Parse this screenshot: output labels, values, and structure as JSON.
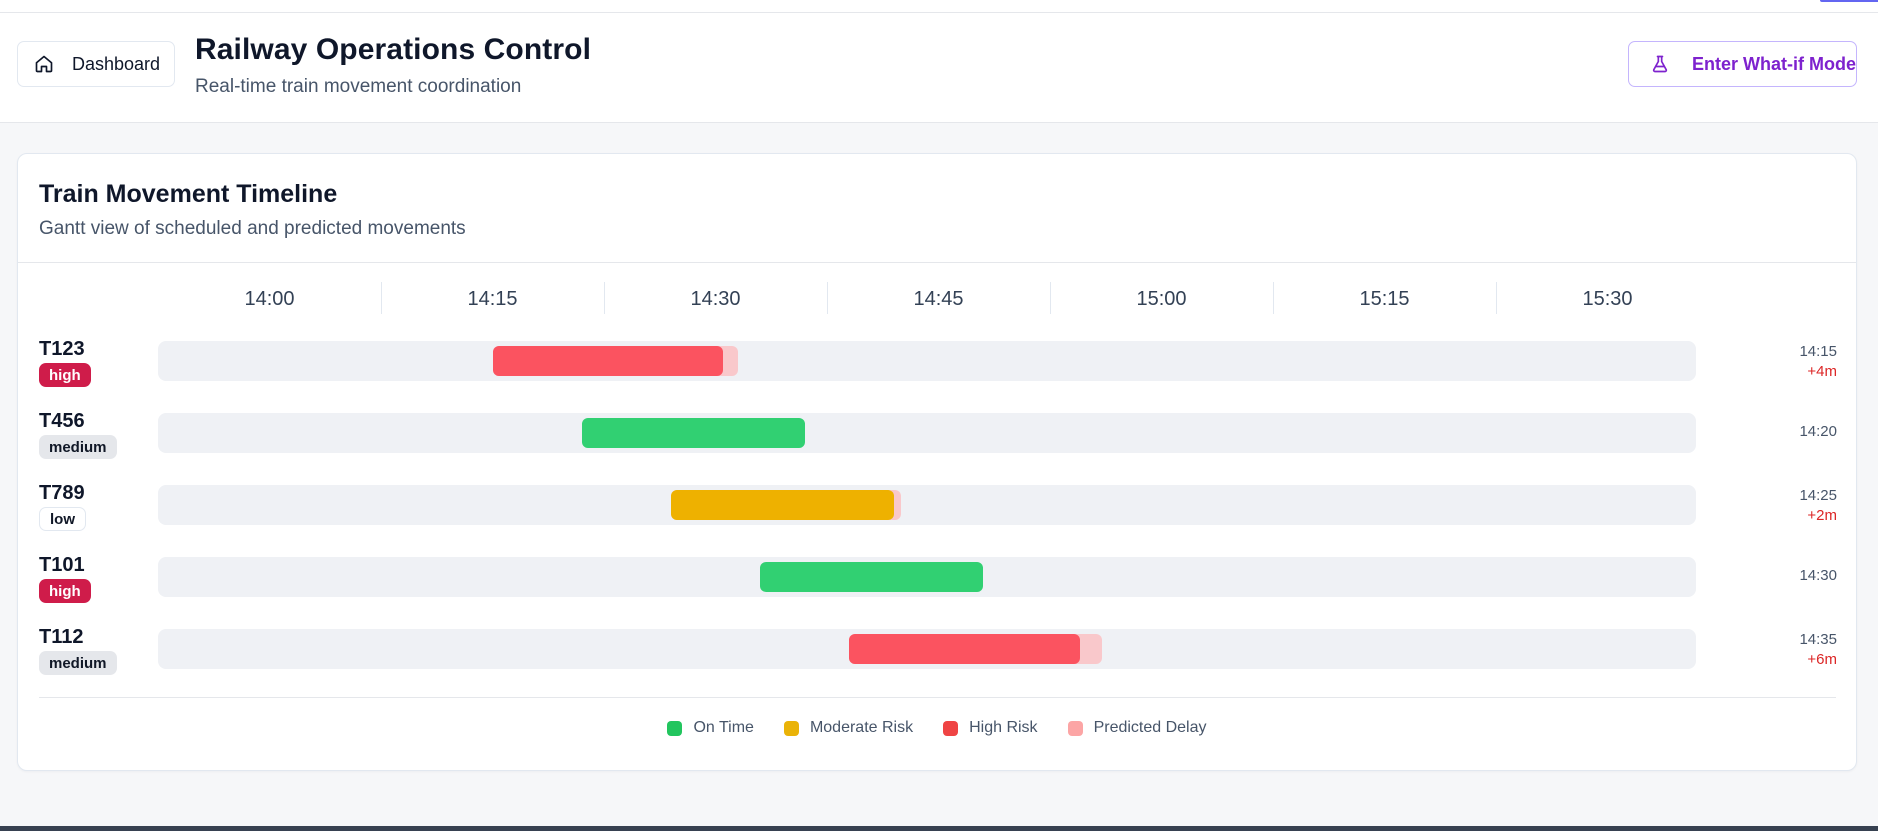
{
  "header": {
    "dashboard_label": "Dashboard",
    "title": "Railway Operations Control",
    "subtitle": "Real-time train movement coordination",
    "whatif_label": "Enter What-if Mode"
  },
  "timeline": {
    "title": "Train Movement Timeline",
    "subtitle": "Gantt view of scheduled and predicted movements",
    "axis_labels": [
      "14:00",
      "14:15",
      "14:30",
      "14:45",
      "15:00",
      "15:15",
      "15:30"
    ],
    "trains": [
      {
        "id": "T123",
        "priority": "high",
        "time": "14:15",
        "delay": "+4m",
        "status": "high-risk",
        "start": "14:15",
        "end": "14:30.5",
        "delay_end": "14:31.5"
      },
      {
        "id": "T456",
        "priority": "medium",
        "time": "14:20",
        "delay": "",
        "status": "on-time",
        "start": "14:21",
        "end": "14:36",
        "delay_end": null
      },
      {
        "id": "T789",
        "priority": "low",
        "time": "14:25",
        "delay": "+2m",
        "status": "moderate-risk",
        "start": "14:27",
        "end": "14:42",
        "delay_end": "14:42.5"
      },
      {
        "id": "T101",
        "priority": "high",
        "time": "14:30",
        "delay": "",
        "status": "on-time",
        "start": "14:33",
        "end": "14:48",
        "delay_end": null
      },
      {
        "id": "T112",
        "priority": "medium",
        "time": "14:35",
        "delay": "+6m",
        "status": "high-risk",
        "start": "14:39",
        "end": "14:54.5",
        "delay_end": "14:56"
      }
    ]
  },
  "legend": [
    {
      "label": "On Time",
      "color": "#22c55e"
    },
    {
      "label": "Moderate Risk",
      "color": "#eab308"
    },
    {
      "label": "High Risk",
      "color": "#ef4444"
    },
    {
      "label": "Predicted Delay",
      "color": "#fca5a5"
    }
  ],
  "colors": {
    "on-time": "#31d072",
    "moderate-risk": "#eeb100",
    "high-risk": "#fb5360",
    "predicted-delay": "#f9c8cb",
    "accent": "#7e22ce"
  }
}
